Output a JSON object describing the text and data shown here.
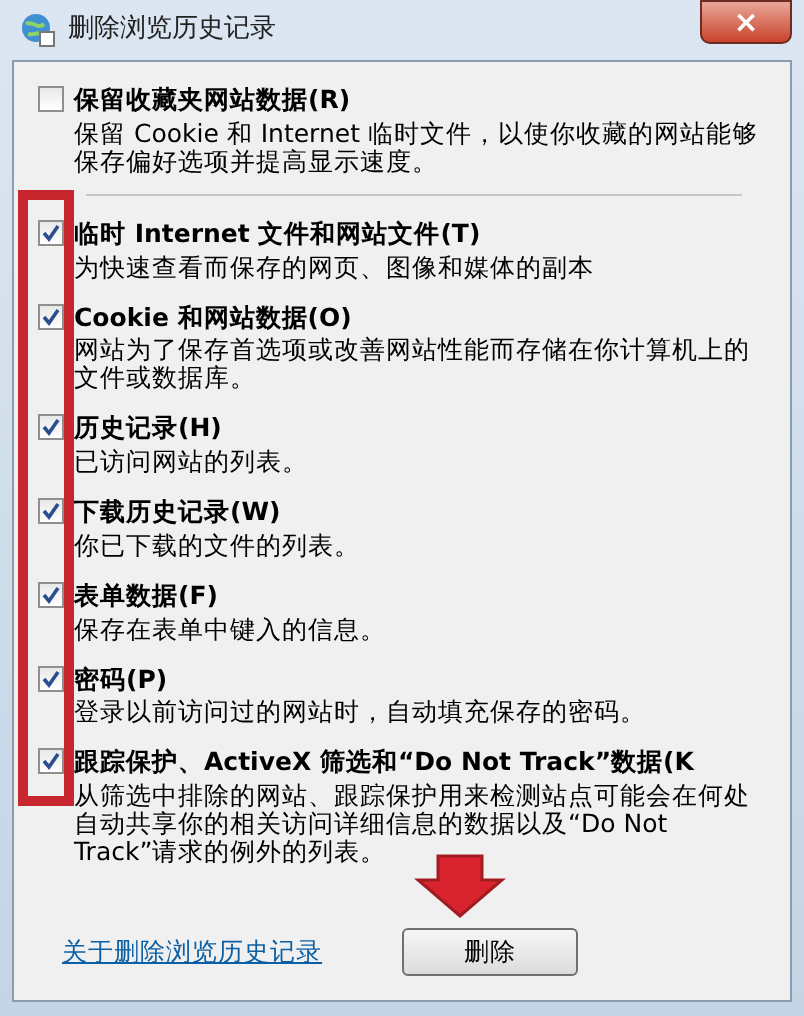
{
  "window": {
    "title": "删除浏览历史记录",
    "close": "×"
  },
  "options": [
    {
      "label": "保留收藏夹网站数据(R)",
      "description": "保留 Cookie 和 Internet 临时文件，以使你收藏的网站能够保存偏好选项并提高显示速度。",
      "checked": false
    },
    {
      "label": "临时 Internet 文件和网站文件(T)",
      "description": "为快速查看而保存的网页、图像和媒体的副本",
      "checked": true
    },
    {
      "label": "Cookie 和网站数据(O)",
      "description": "网站为了保存首选项或改善网站性能而存储在你计算机上的文件或数据库。",
      "checked": true
    },
    {
      "label": "历史记录(H)",
      "description": "已访问网站的列表。",
      "checked": true
    },
    {
      "label": "下载历史记录(W)",
      "description": "你已下载的文件的列表。",
      "checked": true
    },
    {
      "label": "表单数据(F)",
      "description": "保存在表单中键入的信息。",
      "checked": true
    },
    {
      "label": "密码(P)",
      "description": "登录以前访问过的网站时，自动填充保存的密码。",
      "checked": true
    },
    {
      "label": "跟踪保护、ActiveX 筛选和“Do Not Track”数据(K",
      "description": "从筛选中排除的网站、跟踪保护用来检测站点可能会在何处自动共享你的相关访问详细信息的数据以及“Do Not Track”请求的例外的列表。",
      "checked": true
    }
  ],
  "footer": {
    "link": "关于删除浏览历史记录",
    "button": "删除"
  }
}
